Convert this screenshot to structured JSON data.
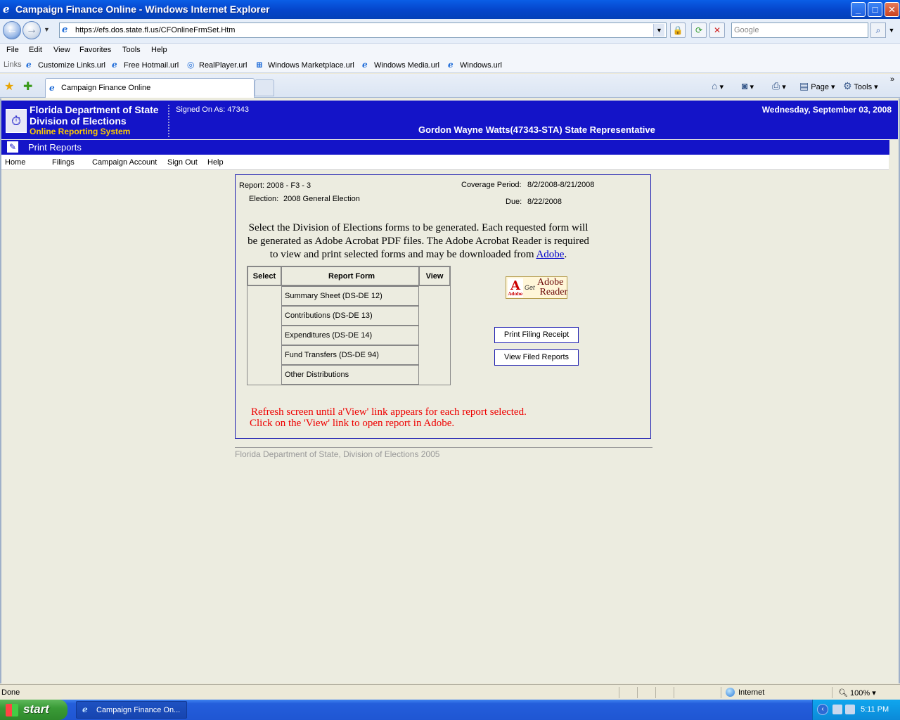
{
  "window": {
    "title": "Campaign Finance Online - Windows Internet Explorer",
    "min": "_",
    "max": "□",
    "close": "✕"
  },
  "browser": {
    "url": "https://efs.dos.state.fl.us/CFOnlineFrmSet.Htm",
    "search_placeholder": "Google",
    "menu": [
      "File",
      "Edit",
      "View",
      "Favorites",
      "Tools",
      "Help"
    ],
    "links_label": "Links",
    "links": [
      "Customize Links.url",
      "Free Hotmail.url",
      "RealPlayer.url",
      "Windows Marketplace.url",
      "Windows Media.url",
      "Windows.url"
    ],
    "tab_title": "Campaign Finance Online",
    "cmd_page": "Page",
    "cmd_tools": "Tools"
  },
  "header": {
    "org_line1": "Florida Department of State",
    "org_line2": "Division of Elections",
    "org_line3": "Online Reporting System",
    "signed_on": "Signed On As: 47343",
    "date": "Wednesday, September 03, 2008",
    "candidate": "Gordon Wayne Watts(47343-STA) State Representative"
  },
  "section_title": "Print Reports",
  "nav": [
    "Home",
    "Filings",
    "Campaign Account",
    "Sign Out",
    "Help"
  ],
  "report": {
    "report": "Report: 2008 - F3 - 3",
    "election_label": "Election:",
    "election": "2008 General Election",
    "coverage_label": "Coverage Period:",
    "coverage": "8/2/2008-8/21/2008",
    "due_label": "Due:",
    "due": "8/22/2008"
  },
  "instructions": {
    "text": "Select the Division of Elections forms to be generated. Each requested form will be generated as Adobe Acrobat PDF files. The Adobe Acrobat Reader is required to view and print selected forms and may be downloaded from",
    "link": "Adobe",
    "end": "."
  },
  "table": {
    "headers": [
      "Select",
      "Report Form",
      "View"
    ],
    "rows": [
      "Summary Sheet (DS-DE 12)",
      "Contributions (DS-DE 13)",
      "Expenditures (DS-DE 14)",
      "Fund Transfers (DS-DE 94)",
      "Other Distributions"
    ]
  },
  "adobe_badge": {
    "brand": "Adobe",
    "get": "Get",
    "adobe": "Adobe",
    "reader": "Reader"
  },
  "buttons": {
    "print_receipt": "Print Filing Receipt",
    "view_filed": "View Filed Reports"
  },
  "notes": [
    "Refresh screen until a'View' link appears for each report selected.",
    "Click on the 'View' link to open report in Adobe."
  ],
  "footer": "Florida Department of State, Division of Elections 2005",
  "status": {
    "text": "Done",
    "zone": "Internet",
    "zoom": "100%"
  },
  "taskbar": {
    "start": "start",
    "item": "Campaign Finance On...",
    "clock": "5:11 PM"
  }
}
